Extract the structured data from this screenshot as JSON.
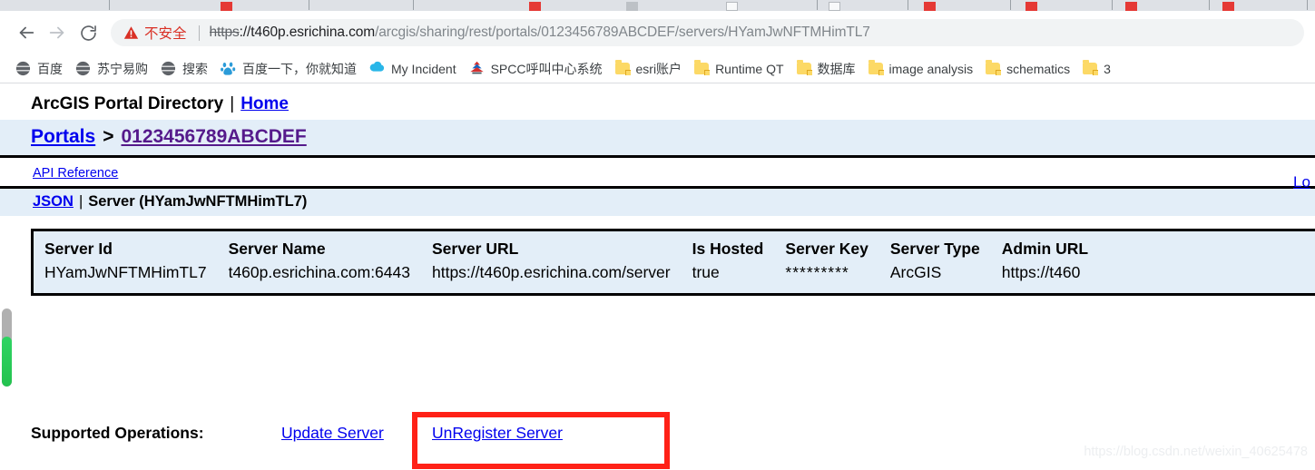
{
  "browser": {
    "back_label": "back-arrow",
    "forward_label": "forward-arrow",
    "reload_label": "reload",
    "security_text": "不安全",
    "url_scheme": "https",
    "url_scheme_suffix": "://",
    "url_host": "t460p.esrichina.com",
    "url_path": "/arcgis/sharing/rest/portals/0123456789ABCDEF/servers/HYamJwNFTMHimTL7",
    "url_full": "https://t460p.esrichina.com/arcgis/sharing/rest/portals/0123456789ABCDEF/servers/HYamJwNFTMHimTL7"
  },
  "bookmarks": [
    {
      "label": "百度",
      "icon": "globe-icon"
    },
    {
      "label": "苏宁易购",
      "icon": "globe-icon"
    },
    {
      "label": "搜索",
      "icon": "globe-icon"
    },
    {
      "label": "百度一下，你就知道",
      "icon": "baidu-paw-icon"
    },
    {
      "label": "My Incident",
      "icon": "cloud-icon"
    },
    {
      "label": "SPCC呼叫中心系统",
      "icon": "spcc-icon"
    },
    {
      "label": "esri账户",
      "icon": "folder-icon"
    },
    {
      "label": "Runtime QT",
      "icon": "folder-icon"
    },
    {
      "label": "数据库",
      "icon": "folder-icon"
    },
    {
      "label": "image analysis",
      "icon": "folder-icon"
    },
    {
      "label": "schematics",
      "icon": "folder-icon"
    },
    {
      "label": "3",
      "icon": "folder-icon"
    }
  ],
  "page": {
    "app_title": "ArcGIS Portal Directory",
    "title_separator": "|",
    "home_link": "Home",
    "logout_link": "Lo",
    "breadcrumb": {
      "root": "Portals",
      "arrow": ">",
      "current": "0123456789ABCDEF"
    },
    "api_reference": "API Reference",
    "json_link": "JSON",
    "json_pipe": "|",
    "resource_title": "Server (HYamJwNFTMHimTL7)",
    "watermark": "https://blog.csdn.net/weixin_40625478"
  },
  "server_table": {
    "headers": [
      "Server Id",
      "Server Name",
      "Server URL",
      "Is Hosted",
      "Server Key",
      "Server Type",
      "Admin URL"
    ],
    "row": [
      "HYamJwNFTMHimTL7",
      "t460p.esrichina.com:6443",
      "https://t460p.esrichina.com/server",
      "true",
      "*********",
      "ArcGIS",
      "https://t460"
    ]
  },
  "supported_operations": {
    "label": "Supported Operations:",
    "operations": [
      {
        "label": "Update Server",
        "highlighted": false
      },
      {
        "label": "UnRegister Server",
        "highlighted": true
      }
    ]
  },
  "colors": {
    "link": "#0000ee",
    "visited_link": "#551a8b",
    "highlight_border": "#ff2117",
    "table_bg": "#e3eef8",
    "warning_red": "#d93025",
    "scroll_green": "#2fd463"
  }
}
